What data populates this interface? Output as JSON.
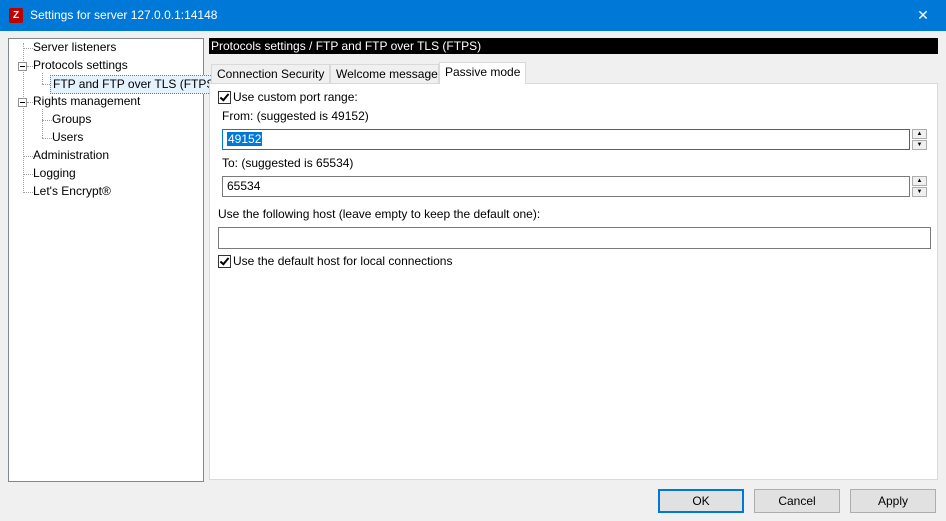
{
  "window": {
    "title": "Settings for server 127.0.0.1:14148",
    "app_icon_glyph": "Z",
    "close_glyph": "✕"
  },
  "tree": {
    "items": [
      {
        "label": "Server listeners"
      },
      {
        "label": "Protocols settings"
      },
      {
        "label": "FTP and FTP over TLS (FTPS)"
      },
      {
        "label": "Rights management"
      },
      {
        "label": "Groups"
      },
      {
        "label": "Users"
      },
      {
        "label": "Administration"
      },
      {
        "label": "Logging"
      },
      {
        "label": "Let's Encrypt®"
      }
    ]
  },
  "panel": {
    "header": "Protocols settings / FTP and FTP over TLS (FTPS)",
    "tabs": [
      {
        "label": "Connection Security"
      },
      {
        "label": "Welcome message"
      },
      {
        "label": "Passive mode"
      }
    ],
    "active_tab": "Passive mode"
  },
  "passive": {
    "use_custom_range_label": "Use custom port range:",
    "use_custom_range_checked": true,
    "from_label": "From: (suggested is 49152)",
    "from_value": "49152",
    "to_label": "To: (suggested is 65534)",
    "to_value": "65534",
    "host_label": "Use the following host (leave empty to keep the default one):",
    "host_value": "",
    "default_host_local_label": "Use the default host for local connections",
    "default_host_local_checked": true,
    "spin_up_glyph": "▲",
    "spin_down_glyph": "▼"
  },
  "buttons": {
    "ok": "OK",
    "cancel": "Cancel",
    "apply": "Apply"
  },
  "colors": {
    "titlebar": "#0078d7",
    "selection": "#0078d7",
    "header_bg": "#000000"
  }
}
